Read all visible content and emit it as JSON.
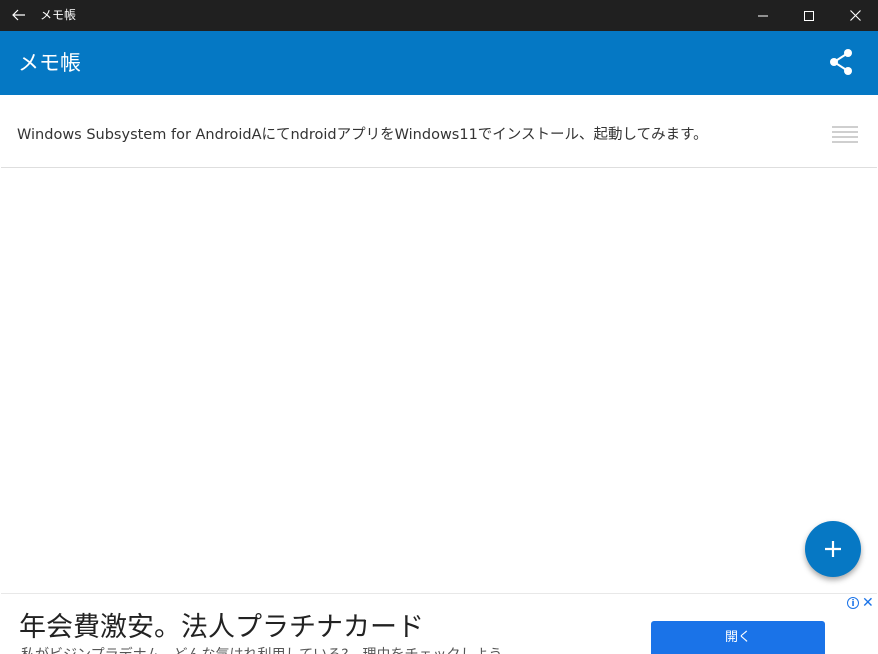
{
  "window": {
    "title": "メモ帳"
  },
  "appbar": {
    "title": "メモ帳",
    "share_icon": "share-icon"
  },
  "memos": [
    {
      "text": "Windows Subsystem for AndroidAにてndroidアプリをWindows11でインストール、起動してみます。"
    }
  ],
  "fab": {
    "icon": "plus-icon",
    "label": "+"
  },
  "ad": {
    "headline": "年会費激安。法人プラチナカード",
    "sub": "私がビジンプラデナム...どんな気はれ利用している?　理由をチェックしよう",
    "open_label": "開く",
    "info_label": "i",
    "close_label": "✕"
  },
  "colors": {
    "titlebar": "#202020",
    "accent": "#0578c4",
    "ad_button": "#1a73e8"
  }
}
